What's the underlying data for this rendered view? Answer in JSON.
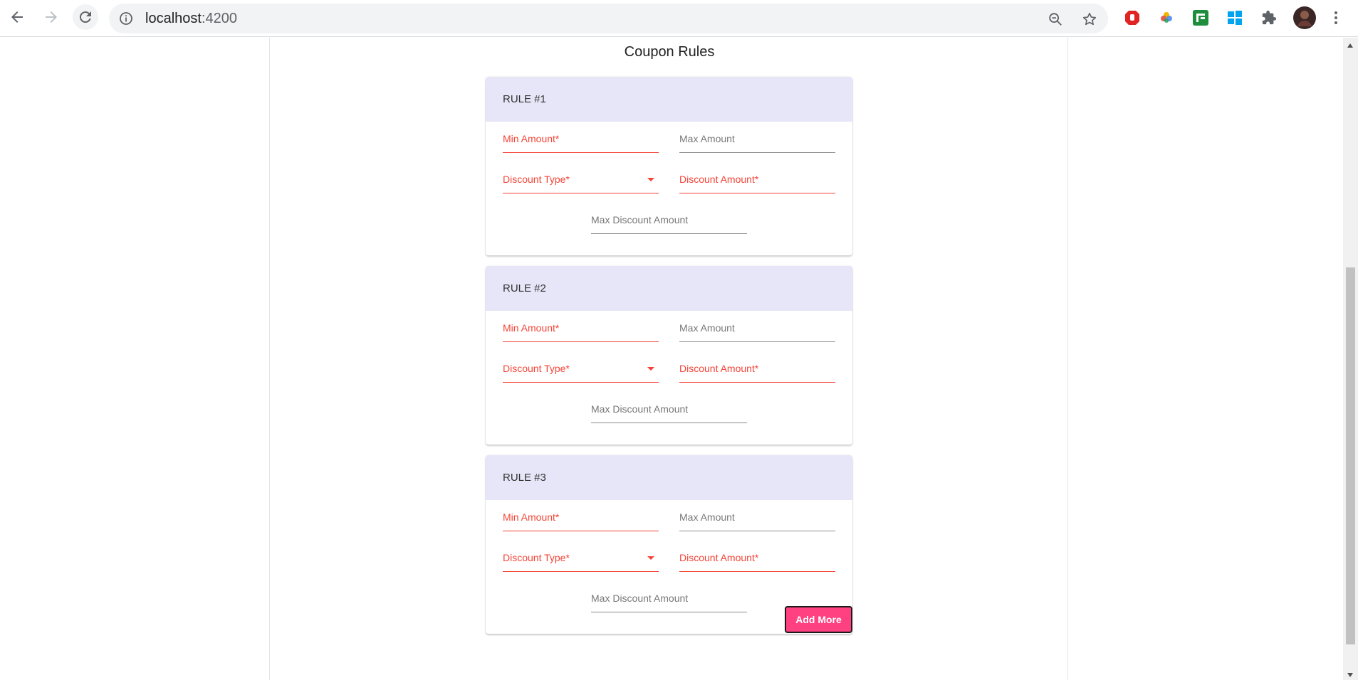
{
  "browser": {
    "url_host": "localhost",
    "url_port": ":4200",
    "icons": [
      "back-icon",
      "forward-icon",
      "reload-icon",
      "info-icon",
      "zoom-icon",
      "star-icon",
      "extensions-icon",
      "menu-icon"
    ]
  },
  "page": {
    "title": "Coupon Rules",
    "rules": [
      {
        "heading": "RULE #1",
        "min_amount": "Min Amount*",
        "max_amount": "Max Amount",
        "discount_type": "Discount Type*",
        "discount_amount": "Discount Amount*",
        "max_discount": "Max Discount Amount"
      },
      {
        "heading": "RULE #2",
        "min_amount": "Min Amount*",
        "max_amount": "Max Amount",
        "discount_type": "Discount Type*",
        "discount_amount": "Discount Amount*",
        "max_discount": "Max Discount Amount"
      },
      {
        "heading": "RULE #3",
        "min_amount": "Min Amount*",
        "max_amount": "Max Amount",
        "discount_type": "Discount Type*",
        "discount_amount": "Discount Amount*",
        "max_discount": "Max Discount Amount"
      }
    ],
    "add_more_label": "Add More"
  },
  "colors": {
    "required": "#f44336",
    "header_bg": "#e6e6f8",
    "accent_button": "#ff4081"
  }
}
